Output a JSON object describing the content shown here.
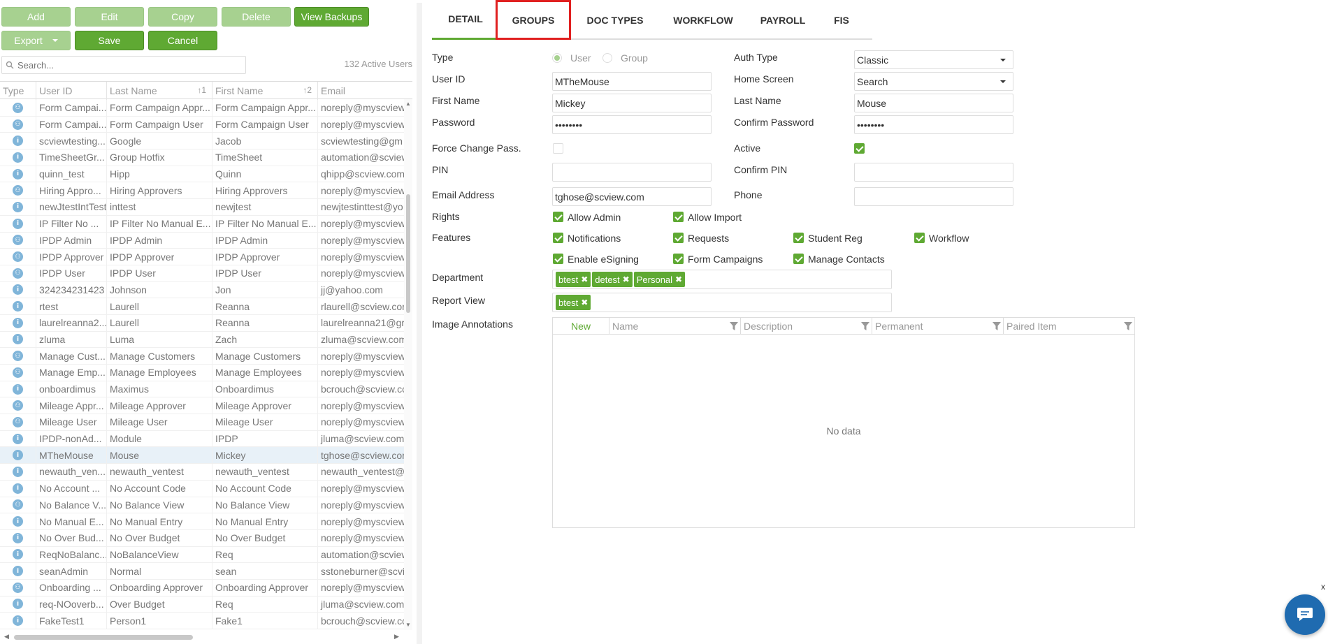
{
  "toolbar": {
    "add": "Add",
    "edit": "Edit",
    "copy": "Copy",
    "delete": "Delete",
    "view_backups": "View Backups",
    "export": "Export",
    "save": "Save",
    "cancel": "Cancel"
  },
  "search": {
    "placeholder": "Search..."
  },
  "active_count": "132 Active Users",
  "grid": {
    "columns": [
      "Type",
      "User ID",
      "Last Name",
      "First Name",
      "Email"
    ],
    "sort_last": "↑1",
    "sort_first": "↑2",
    "rows": [
      {
        "type": "group",
        "uid": "Form Campai...",
        "last": "Form Campaign Appr...",
        "first": "Form Campaign Appr...",
        "email": "noreply@myscview"
      },
      {
        "type": "group",
        "uid": "Form Campai...",
        "last": "Form Campaign User",
        "first": "Form Campaign User",
        "email": "noreply@myscview"
      },
      {
        "type": "user",
        "uid": "scviewtesting...",
        "last": "Google",
        "first": "Jacob",
        "email": "scviewtesting@gm"
      },
      {
        "type": "user",
        "uid": "TimeSheetGr...",
        "last": "Group Hotfix",
        "first": "TimeSheet",
        "email": "automation@scview"
      },
      {
        "type": "user",
        "uid": "quinn_test",
        "last": "Hipp",
        "first": "Quinn",
        "email": "qhipp@scview.com"
      },
      {
        "type": "group",
        "uid": "Hiring Appro...",
        "last": "Hiring Approvers",
        "first": "Hiring Approvers",
        "email": "noreply@myscview"
      },
      {
        "type": "user",
        "uid": "newJtestIntTest",
        "last": "inttest",
        "first": "newjtest",
        "email": "newjtestinttest@yo"
      },
      {
        "type": "user",
        "uid": "IP Filter No ...",
        "last": "IP Filter No Manual E...",
        "first": "IP Filter No Manual E...",
        "email": "noreply@myscview"
      },
      {
        "type": "group",
        "uid": "IPDP Admin",
        "last": "IPDP Admin",
        "first": "IPDP Admin",
        "email": "noreply@myscview"
      },
      {
        "type": "group",
        "uid": "IPDP Approver",
        "last": "IPDP Approver",
        "first": "IPDP Approver",
        "email": "noreply@myscview"
      },
      {
        "type": "group",
        "uid": "IPDP User",
        "last": "IPDP User",
        "first": "IPDP User",
        "email": "noreply@myscview"
      },
      {
        "type": "user",
        "uid": "324234231423",
        "last": "Johnson",
        "first": "Jon",
        "email": "jj@yahoo.com"
      },
      {
        "type": "user",
        "uid": "rtest",
        "last": "Laurell",
        "first": "Reanna",
        "email": "rlaurell@scview.cor"
      },
      {
        "type": "user",
        "uid": "laurelreanna2...",
        "last": "Laurell",
        "first": "Reanna",
        "email": "laurelreanna21@gr"
      },
      {
        "type": "user",
        "uid": "zluma",
        "last": "Luma",
        "first": "Zach",
        "email": "zluma@scview.com"
      },
      {
        "type": "group",
        "uid": "Manage Cust...",
        "last": "Manage Customers",
        "first": "Manage Customers",
        "email": "noreply@myscview"
      },
      {
        "type": "group",
        "uid": "Manage Emp...",
        "last": "Manage Employees",
        "first": "Manage Employees",
        "email": "noreply@myscview"
      },
      {
        "type": "user",
        "uid": "onboardimus",
        "last": "Maximus",
        "first": "Onboardimus",
        "email": "bcrouch@scview.cc"
      },
      {
        "type": "group",
        "uid": "Mileage Appr...",
        "last": "Mileage Approver",
        "first": "Mileage Approver",
        "email": "noreply@myscview"
      },
      {
        "type": "group",
        "uid": "Mileage User",
        "last": "Mileage User",
        "first": "Mileage User",
        "email": "noreply@myscview"
      },
      {
        "type": "user",
        "uid": "IPDP-nonAd...",
        "last": "Module",
        "first": "IPDP",
        "email": "jluma@scview.com"
      },
      {
        "type": "user",
        "uid": "MTheMouse",
        "last": "Mouse",
        "first": "Mickey",
        "email": "tghose@scview.cor",
        "selected": true
      },
      {
        "type": "user",
        "uid": "newauth_ven...",
        "last": "newauth_ventest",
        "first": "newauth_ventest",
        "email": "newauth_ventest@"
      },
      {
        "type": "user",
        "uid": "No Account ...",
        "last": "No Account Code",
        "first": "No Account Code",
        "email": "noreply@myscview"
      },
      {
        "type": "group",
        "uid": "No Balance V...",
        "last": "No Balance View",
        "first": "No Balance View",
        "email": "noreply@myscview"
      },
      {
        "type": "user",
        "uid": "No Manual E...",
        "last": "No Manual Entry",
        "first": "No Manual Entry",
        "email": "noreply@myscview"
      },
      {
        "type": "user",
        "uid": "No Over Bud...",
        "last": "No Over Budget",
        "first": "No Over Budget",
        "email": "noreply@myscview"
      },
      {
        "type": "user",
        "uid": "ReqNoBalanc...",
        "last": "NoBalanceView",
        "first": "Req",
        "email": "automation@scview"
      },
      {
        "type": "user",
        "uid": "seanAdmin",
        "last": "Normal",
        "first": "sean",
        "email": "sstoneburner@scvi"
      },
      {
        "type": "group",
        "uid": "Onboarding ...",
        "last": "Onboarding Approver",
        "first": "Onboarding Approver",
        "email": "noreply@myscview"
      },
      {
        "type": "user",
        "uid": "req-NOoverb...",
        "last": "Over Budget",
        "first": "Req",
        "email": "jluma@scview.com"
      },
      {
        "type": "user",
        "uid": "FakeTest1",
        "last": "Person1",
        "first": "Fake1",
        "email": "bcrouch@scview.cc"
      }
    ]
  },
  "tabs": [
    "DETAIL",
    "GROUPS",
    "DOC TYPES",
    "WORKFLOW",
    "PAYROLL",
    "FIS"
  ],
  "form": {
    "type_label": "Type",
    "type_user": "User",
    "type_group": "Group",
    "auth_type_label": "Auth Type",
    "auth_type_value": "Classic",
    "user_id_label": "User ID",
    "user_id_value": "MTheMouse",
    "home_screen_label": "Home Screen",
    "home_screen_value": "Search",
    "first_name_label": "First Name",
    "first_name_value": "Mickey",
    "last_name_label": "Last Name",
    "last_name_value": "Mouse",
    "password_label": "Password",
    "password_value": "••••••••",
    "confirm_password_label": "Confirm Password",
    "confirm_password_value": "••••••••",
    "force_change_label": "Force Change Pass.",
    "active_label": "Active",
    "pin_label": "PIN",
    "confirm_pin_label": "Confirm PIN",
    "email_label": "Email Address",
    "email_value": "tghose@scview.com",
    "phone_label": "Phone",
    "rights_label": "Rights",
    "allow_admin": "Allow Admin",
    "allow_import": "Allow Import",
    "features_label": "Features",
    "notifications": "Notifications",
    "requests": "Requests",
    "student_reg": "Student Reg",
    "workflow": "Workflow",
    "esigning": "Enable eSigning",
    "form_campaigns": "Form Campaigns",
    "manage_contacts": "Manage Contacts",
    "department_label": "Department",
    "departments": [
      "btest",
      "detest",
      "Personal"
    ],
    "report_view_label": "Report View",
    "report_views": [
      "btest"
    ],
    "annotations_label": "Image Annotations",
    "ann_cols": [
      "New",
      "Name",
      "Description",
      "Permanent",
      "Paired Item"
    ],
    "ann_empty": "No data"
  },
  "chat": {
    "close": "x"
  },
  "colors": {
    "accent": "#5fa933",
    "accent_disabled": "#a7d190",
    "highlight": "#e02020",
    "chat": "#1f6bb0"
  }
}
